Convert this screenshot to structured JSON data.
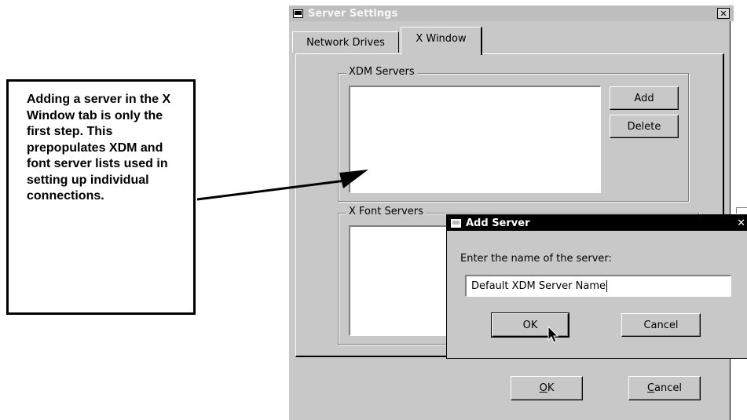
{
  "callout": {
    "text": "Adding a server in the X Window tab is only the first step. This prepopulates XDM and font server lists used in setting up individual connections."
  },
  "server_settings": {
    "title": "Server Settings",
    "tabs": [
      {
        "label": "Network Drives",
        "active": false
      },
      {
        "label": "X Window",
        "active": true
      }
    ],
    "xdm_group": {
      "legend": "XDM Servers",
      "add_label": "Add",
      "delete_label": "Delete"
    },
    "font_group": {
      "legend": "X Font Servers"
    },
    "ok_label": "OK",
    "ok_mnemonic": "O",
    "ok_rest": "K",
    "cancel_label": "Cancel",
    "cancel_mnemonic": "C",
    "cancel_rest": "ancel"
  },
  "add_server": {
    "title": "Add Server",
    "prompt": "Enter the name of the server:",
    "input_value": "Default XDM Server Name",
    "ok_label": "OK",
    "cancel_label": "Cancel"
  },
  "icons": {
    "window_icon": "monitor-icon",
    "close": "close-icon",
    "cursor": "mouse-pointer-icon"
  },
  "colors": {
    "window_bg": "#c8c8c8",
    "active_title": "#000000",
    "inactive_title": "#bebebe",
    "field_bg": "#ffffff"
  }
}
